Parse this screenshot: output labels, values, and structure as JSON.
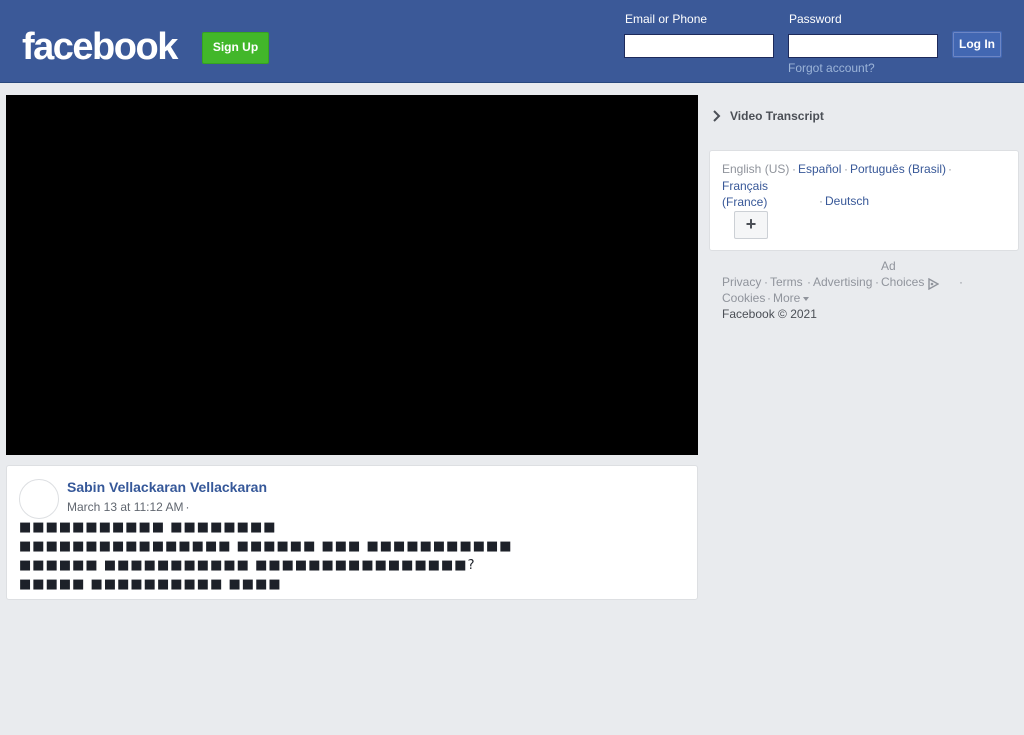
{
  "header": {
    "logo": "facebook",
    "signup_label": "Sign Up",
    "email_label": "Email or Phone",
    "email_value": "",
    "password_label": "Password",
    "password_value": "",
    "login_label": "Log In",
    "forgot_label": "Forgot account?"
  },
  "post": {
    "author": "Sabin Vellackaran Vellackaran",
    "date": "March 13 at 11:12 AM",
    "date_sep": "·",
    "text_lines": [
      "■■■■■■■■■■■ ■■■■■■■■",
      "■■■■■■■■■■■■■■■■  ■■■■■■ ■■■ ■■■■■■■■■■■",
      "■■■■■■ ■■■■■■■■■■■ ■■■■■■■■■■■■■■■■?",
      "■■■■■  ■■■■■■■■■■ ■■■■"
    ]
  },
  "sidebar": {
    "transcript_label": "Video Transcript",
    "languages": {
      "current": "English (US)",
      "links": [
        "Español",
        "Português (Brasil)",
        "Français (France)",
        "Deutsch"
      ],
      "more_label": "+"
    },
    "ad_label": "Ad",
    "footer_links": [
      "Privacy",
      "Terms",
      "Advertising",
      "Choices",
      "Cookies",
      "More"
    ],
    "separator": "·",
    "copyright": "Facebook © 2021"
  },
  "colors": {
    "header_bg": "#3b5998",
    "signup_bg": "#42b72a",
    "link": "#365899",
    "page_bg": "#e9ebee"
  }
}
